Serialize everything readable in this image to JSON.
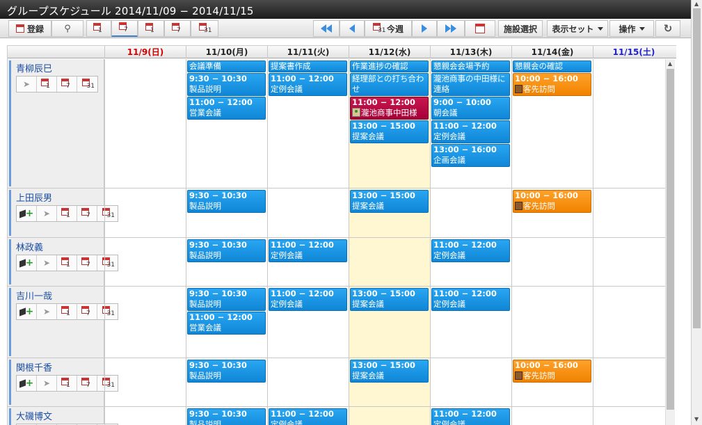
{
  "window": {
    "title": "グループスケジュール 2014/11/09 − 2014/11/15"
  },
  "toolbar": {
    "register_label": "登録",
    "today_label": "今週",
    "facility_label": "施設選択",
    "display_set_label": "表示セット",
    "operation_label": "操作",
    "view_nums": [
      "1",
      "7",
      "1",
      "7",
      "31"
    ],
    "today_num": "31"
  },
  "days": [
    {
      "label": "11/9(日)",
      "type": "sun"
    },
    {
      "label": "11/10(月)",
      "type": ""
    },
    {
      "label": "11/11(火)",
      "type": ""
    },
    {
      "label": "11/12(水)",
      "type": "today"
    },
    {
      "label": "11/13(木)",
      "type": ""
    },
    {
      "label": "11/14(金)",
      "type": ""
    },
    {
      "label": "11/15(土)",
      "type": "sat"
    }
  ],
  "icon_nums": [
    "1",
    "7",
    "31"
  ],
  "users": [
    {
      "name": "青柳辰巳"
    },
    {
      "name": "上田辰男"
    },
    {
      "name": "林政義"
    },
    {
      "name": "吉川一哉"
    },
    {
      "name": "関根千香"
    },
    {
      "name": "大磯博文"
    }
  ],
  "events": [
    {
      "user": 0,
      "day": 1,
      "time": "",
      "title": "会議準備",
      "color": "blue"
    },
    {
      "user": 0,
      "day": 1,
      "time": "9:30 − 10:30",
      "title": "製品説明",
      "color": "blue"
    },
    {
      "user": 0,
      "day": 1,
      "time": "11:00 − 12:00",
      "title": "営業会議",
      "color": "blue"
    },
    {
      "user": 0,
      "day": 2,
      "time": "",
      "title": "提案書作成",
      "color": "blue"
    },
    {
      "user": 0,
      "day": 2,
      "time": "11:00 − 12:00",
      "title": "定例会議",
      "color": "blue"
    },
    {
      "user": 0,
      "day": 3,
      "time": "",
      "title": "作業進捗の確認",
      "color": "blue"
    },
    {
      "user": 0,
      "day": 3,
      "time": "",
      "title": "経理部との打ち合わせ",
      "color": "blue"
    },
    {
      "user": 0,
      "day": 3,
      "time": "11:00 − 12:00",
      "title": "瀧池商事中田様",
      "color": "red",
      "icon": "person"
    },
    {
      "user": 0,
      "day": 3,
      "time": "13:00 − 15:00",
      "title": "提案会議",
      "color": "blue"
    },
    {
      "user": 0,
      "day": 4,
      "time": "",
      "title": "懇親会会場予約",
      "color": "blue"
    },
    {
      "user": 0,
      "day": 4,
      "time": "",
      "title": "瀧池商事の中田様に連絡",
      "color": "blue"
    },
    {
      "user": 0,
      "day": 4,
      "time": "9:00 − 10:00",
      "title": "朝会議",
      "color": "blue"
    },
    {
      "user": 0,
      "day": 4,
      "time": "11:00 − 12:00",
      "title": "定例会議",
      "color": "blue"
    },
    {
      "user": 0,
      "day": 4,
      "time": "13:00 − 16:00",
      "title": "企画会議",
      "color": "blue"
    },
    {
      "user": 0,
      "day": 5,
      "time": "",
      "title": "懇親会の確認",
      "color": "blue"
    },
    {
      "user": 0,
      "day": 5,
      "time": "10:00 − 16:00",
      "title": "客先訪問",
      "color": "orange",
      "icon": "book"
    },
    {
      "user": 1,
      "day": 1,
      "time": "9:30 − 10:30",
      "title": "製品説明",
      "color": "blue"
    },
    {
      "user": 1,
      "day": 3,
      "time": "13:00 − 15:00",
      "title": "提案会議",
      "color": "blue"
    },
    {
      "user": 1,
      "day": 5,
      "time": "10:00 − 16:00",
      "title": "客先訪問",
      "color": "orange",
      "icon": "book"
    },
    {
      "user": 2,
      "day": 1,
      "time": "9:30 − 10:30",
      "title": "製品説明",
      "color": "blue"
    },
    {
      "user": 2,
      "day": 2,
      "time": "11:00 − 12:00",
      "title": "定例会議",
      "color": "blue"
    },
    {
      "user": 2,
      "day": 4,
      "time": "11:00 − 12:00",
      "title": "定例会議",
      "color": "blue"
    },
    {
      "user": 3,
      "day": 1,
      "time": "9:30 − 10:30",
      "title": "製品説明",
      "color": "blue"
    },
    {
      "user": 3,
      "day": 1,
      "time": "11:00 − 12:00",
      "title": "営業会議",
      "color": "blue"
    },
    {
      "user": 3,
      "day": 2,
      "time": "11:00 − 12:00",
      "title": "定例会議",
      "color": "blue"
    },
    {
      "user": 3,
      "day": 3,
      "time": "13:00 − 15:00",
      "title": "提案会議",
      "color": "blue"
    },
    {
      "user": 3,
      "day": 4,
      "time": "11:00 − 12:00",
      "title": "定例会議",
      "color": "blue"
    },
    {
      "user": 4,
      "day": 1,
      "time": "9:30 − 10:30",
      "title": "製品説明",
      "color": "blue"
    },
    {
      "user": 4,
      "day": 3,
      "time": "13:00 − 15:00",
      "title": "提案会議",
      "color": "blue"
    },
    {
      "user": 4,
      "day": 5,
      "time": "10:00 − 16:00",
      "title": "客先訪問",
      "color": "orange",
      "icon": "book"
    },
    {
      "user": 5,
      "day": 1,
      "time": "9:30 − 10:30",
      "title": "製品説明",
      "color": "blue"
    },
    {
      "user": 5,
      "day": 2,
      "time": "11:00 − 12:00",
      "title": "定例会議",
      "color": "blue"
    },
    {
      "user": 5,
      "day": 4,
      "time": "11:00 − 12:00",
      "title": "定例会議",
      "color": "blue"
    }
  ]
}
